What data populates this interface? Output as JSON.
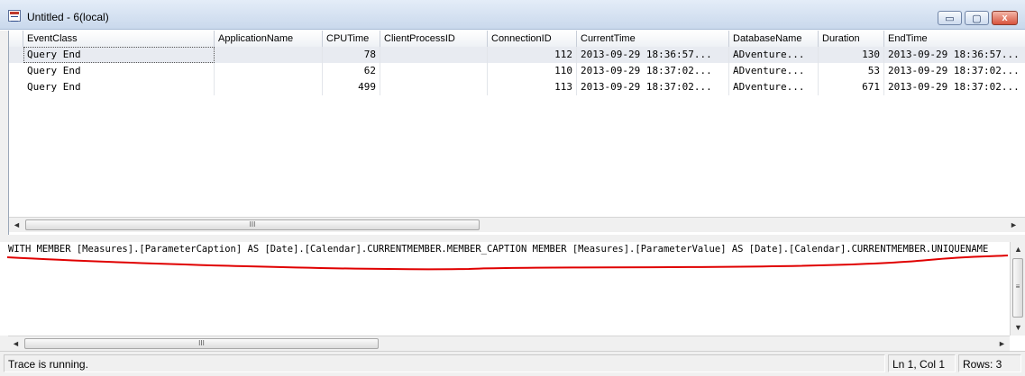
{
  "window": {
    "title": "Untitled - 6(local)",
    "minimize_glyph": "▭",
    "maximize_glyph": "▢",
    "close_glyph": "x"
  },
  "grid": {
    "columns": [
      "EventClass",
      "ApplicationName",
      "CPUTime",
      "ClientProcessID",
      "ConnectionID",
      "CurrentTime",
      "DatabaseName",
      "Duration",
      "EndTime"
    ],
    "rows": [
      [
        "Query End",
        "",
        "78",
        "",
        "112",
        "2013-09-29 18:36:57...",
        "ADventure...",
        "130",
        "2013-09-29 18:36:57..."
      ],
      [
        "Query End",
        "",
        "62",
        "",
        "110",
        "2013-09-29 18:37:02...",
        "ADventure...",
        "53",
        "2013-09-29 18:37:02..."
      ],
      [
        "Query End",
        "",
        "499",
        "",
        "113",
        "2013-09-29 18:37:02...",
        "ADventure...",
        "671",
        "2013-09-29 18:37:02..."
      ]
    ],
    "selected_row": 0
  },
  "scroll": {
    "left_arrow": "◄",
    "right_arrow": "►",
    "up_arrow": "▲",
    "down_arrow": "▼",
    "grip": "III",
    "vgrip": "≡"
  },
  "query_text": "WITH MEMBER [Measures].[ParameterCaption] AS [Date].[Calendar].CURRENTMEMBER.MEMBER_CAPTION MEMBER [Measures].[ParameterValue] AS [Date].[Calendar].CURRENTMEMBER.UNIQUENAME",
  "annotation": {
    "color": "#e00000"
  },
  "status": {
    "message": "Trace is running.",
    "position": "Ln 1, Col 1",
    "rows": "Rows: 3"
  }
}
